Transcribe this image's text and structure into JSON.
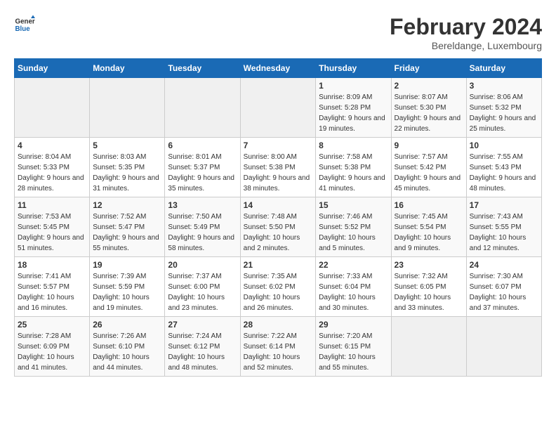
{
  "header": {
    "logo": {
      "general": "General",
      "blue": "Blue"
    },
    "title": "February 2024",
    "subtitle": "Bereldange, Luxembourg"
  },
  "calendar": {
    "weekdays": [
      "Sunday",
      "Monday",
      "Tuesday",
      "Wednesday",
      "Thursday",
      "Friday",
      "Saturday"
    ],
    "weeks": [
      [
        {
          "day": "",
          "empty": true
        },
        {
          "day": "",
          "empty": true
        },
        {
          "day": "",
          "empty": true
        },
        {
          "day": "",
          "empty": true
        },
        {
          "day": "1",
          "sunrise": "8:09 AM",
          "sunset": "5:28 PM",
          "daylight": "9 hours and 19 minutes."
        },
        {
          "day": "2",
          "sunrise": "8:07 AM",
          "sunset": "5:30 PM",
          "daylight": "9 hours and 22 minutes."
        },
        {
          "day": "3",
          "sunrise": "8:06 AM",
          "sunset": "5:32 PM",
          "daylight": "9 hours and 25 minutes."
        }
      ],
      [
        {
          "day": "4",
          "sunrise": "8:04 AM",
          "sunset": "5:33 PM",
          "daylight": "9 hours and 28 minutes."
        },
        {
          "day": "5",
          "sunrise": "8:03 AM",
          "sunset": "5:35 PM",
          "daylight": "9 hours and 31 minutes."
        },
        {
          "day": "6",
          "sunrise": "8:01 AM",
          "sunset": "5:37 PM",
          "daylight": "9 hours and 35 minutes."
        },
        {
          "day": "7",
          "sunrise": "8:00 AM",
          "sunset": "5:38 PM",
          "daylight": "9 hours and 38 minutes."
        },
        {
          "day": "8",
          "sunrise": "7:58 AM",
          "sunset": "5:38 PM",
          "daylight": "9 hours and 41 minutes."
        },
        {
          "day": "9",
          "sunrise": "7:57 AM",
          "sunset": "5:42 PM",
          "daylight": "9 hours and 45 minutes."
        },
        {
          "day": "10",
          "sunrise": "7:55 AM",
          "sunset": "5:43 PM",
          "daylight": "9 hours and 48 minutes."
        }
      ],
      [
        {
          "day": "11",
          "sunrise": "7:53 AM",
          "sunset": "5:45 PM",
          "daylight": "9 hours and 51 minutes."
        },
        {
          "day": "12",
          "sunrise": "7:52 AM",
          "sunset": "5:47 PM",
          "daylight": "9 hours and 55 minutes."
        },
        {
          "day": "13",
          "sunrise": "7:50 AM",
          "sunset": "5:49 PM",
          "daylight": "9 hours and 58 minutes."
        },
        {
          "day": "14",
          "sunrise": "7:48 AM",
          "sunset": "5:50 PM",
          "daylight": "10 hours and 2 minutes."
        },
        {
          "day": "15",
          "sunrise": "7:46 AM",
          "sunset": "5:52 PM",
          "daylight": "10 hours and 5 minutes."
        },
        {
          "day": "16",
          "sunrise": "7:45 AM",
          "sunset": "5:54 PM",
          "daylight": "10 hours and 9 minutes."
        },
        {
          "day": "17",
          "sunrise": "7:43 AM",
          "sunset": "5:55 PM",
          "daylight": "10 hours and 12 minutes."
        }
      ],
      [
        {
          "day": "18",
          "sunrise": "7:41 AM",
          "sunset": "5:57 PM",
          "daylight": "10 hours and 16 minutes."
        },
        {
          "day": "19",
          "sunrise": "7:39 AM",
          "sunset": "5:59 PM",
          "daylight": "10 hours and 19 minutes."
        },
        {
          "day": "20",
          "sunrise": "7:37 AM",
          "sunset": "6:00 PM",
          "daylight": "10 hours and 23 minutes."
        },
        {
          "day": "21",
          "sunrise": "7:35 AM",
          "sunset": "6:02 PM",
          "daylight": "10 hours and 26 minutes."
        },
        {
          "day": "22",
          "sunrise": "7:33 AM",
          "sunset": "6:04 PM",
          "daylight": "10 hours and 30 minutes."
        },
        {
          "day": "23",
          "sunrise": "7:32 AM",
          "sunset": "6:05 PM",
          "daylight": "10 hours and 33 minutes."
        },
        {
          "day": "24",
          "sunrise": "7:30 AM",
          "sunset": "6:07 PM",
          "daylight": "10 hours and 37 minutes."
        }
      ],
      [
        {
          "day": "25",
          "sunrise": "7:28 AM",
          "sunset": "6:09 PM",
          "daylight": "10 hours and 41 minutes."
        },
        {
          "day": "26",
          "sunrise": "7:26 AM",
          "sunset": "6:10 PM",
          "daylight": "10 hours and 44 minutes."
        },
        {
          "day": "27",
          "sunrise": "7:24 AM",
          "sunset": "6:12 PM",
          "daylight": "10 hours and 48 minutes."
        },
        {
          "day": "28",
          "sunrise": "7:22 AM",
          "sunset": "6:14 PM",
          "daylight": "10 hours and 52 minutes."
        },
        {
          "day": "29",
          "sunrise": "7:20 AM",
          "sunset": "6:15 PM",
          "daylight": "10 hours and 55 minutes."
        },
        {
          "day": "",
          "empty": true
        },
        {
          "day": "",
          "empty": true
        }
      ]
    ]
  }
}
